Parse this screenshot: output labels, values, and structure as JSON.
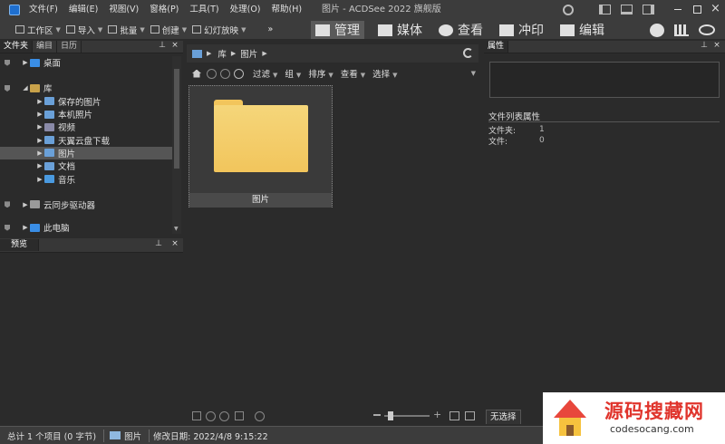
{
  "menu": [
    "文件(F)",
    "编辑(E)",
    "视图(V)",
    "窗格(P)",
    "工具(T)",
    "处理(O)",
    "帮助(H)"
  ],
  "window_title": "图片 - ACDSee 2022 旗舰版",
  "toolbar": {
    "workspace": "工作区",
    "import": "导入",
    "batch": "批量",
    "create": "创建",
    "slideshow": "幻灯放映",
    "more": "»"
  },
  "modes": [
    "管理",
    "媒体",
    "查看",
    "冲印",
    "编辑"
  ],
  "left_panel": {
    "tabs": [
      "文件夹",
      "编目",
      "日历"
    ],
    "tree": [
      {
        "label": "桌面",
        "level": 1,
        "icon": "desktop-icon",
        "color": "#3a8ee6"
      },
      {
        "label": "库",
        "level": 1,
        "icon": "library-icon",
        "color": "#c9a24a"
      },
      {
        "label": "保存的图片",
        "level": 2,
        "icon": "pictures-icon",
        "color": "#6aa0d8"
      },
      {
        "label": "本机照片",
        "level": 2,
        "icon": "pictures-icon",
        "color": "#6aa0d8"
      },
      {
        "label": "视频",
        "level": 2,
        "icon": "video-icon",
        "color": "#8a8aa8"
      },
      {
        "label": "天翼云盘下载",
        "level": 2,
        "icon": "download-icon",
        "color": "#6aa0d8"
      },
      {
        "label": "图片",
        "level": 2,
        "icon": "pictures-icon",
        "color": "#6aa0d8"
      },
      {
        "label": "文档",
        "level": 2,
        "icon": "document-icon",
        "color": "#6aa0d8"
      },
      {
        "label": "音乐",
        "level": 2,
        "icon": "music-icon",
        "color": "#4a9ae0"
      },
      {
        "label": "云同步驱动器",
        "level": 1,
        "icon": "cloud-icon",
        "color": "#9a9a9a"
      },
      {
        "label": "此电脑",
        "level": 1,
        "icon": "computer-icon",
        "color": "#3a8ee6"
      }
    ]
  },
  "preview": {
    "tab": "预览"
  },
  "path": {
    "items": [
      "库",
      "图片"
    ]
  },
  "filterbar": [
    "过滤",
    "组",
    "排序",
    "查看",
    "选择"
  ],
  "file_item": {
    "label": "图片",
    "folder_color": "#f2c55c"
  },
  "properties": {
    "tab": "属性",
    "section": "文件列表属性",
    "rows": [
      {
        "k": "文件夹:",
        "v": "1"
      },
      {
        "k": "文件:",
        "v": "0"
      }
    ],
    "bottom_tab": "无选择"
  },
  "statusbar": {
    "total": "总计 1 个项目 (0 字节)",
    "current": "图片",
    "modified": "修改日期: 2022/4/8 9:15:22"
  },
  "watermark": {
    "text": "源码搜藏网",
    "url": "codesocang.com"
  }
}
